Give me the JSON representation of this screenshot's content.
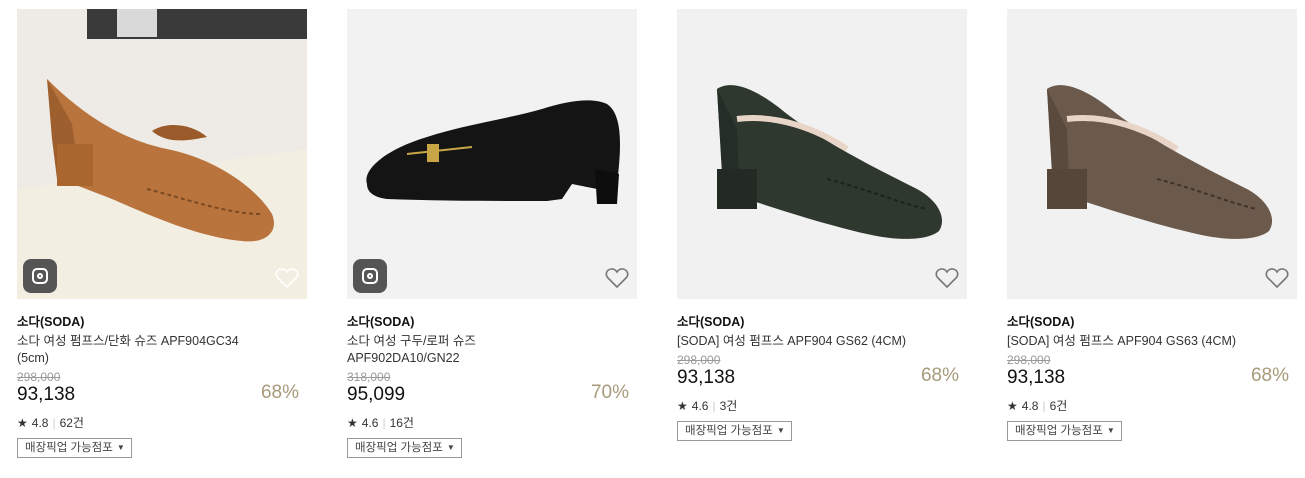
{
  "products": [
    {
      "brand": "소다(SODA)",
      "name": "소다 여성 펌프스/단화 슈즈 APF904GC34 (5cm)",
      "original_price": "298,000",
      "price": "93,138",
      "discount": "68%",
      "rating": "4.8",
      "reviews": "62건",
      "pickup_label": "매장픽업 가능점포",
      "has_instagram": true,
      "shoe_color": "#b8733f"
    },
    {
      "brand": "소다(SODA)",
      "name": "소다 여성 구두/로퍼 슈즈 APF902DA10/GN22",
      "original_price": "318,000",
      "price": "95,099",
      "discount": "70%",
      "rating": "4.6",
      "reviews": "16건",
      "pickup_label": "매장픽업 가능점포",
      "has_instagram": true,
      "shoe_color": "#151515"
    },
    {
      "brand": "소다(SODA)",
      "name": "[SODA] 여성 펌프스 APF904 GS62 (4CM)",
      "original_price": "298,000",
      "price": "93,138",
      "discount": "68%",
      "rating": "4.6",
      "reviews": "3건",
      "pickup_label": "매장픽업 가능점포",
      "has_instagram": false,
      "shoe_color": "#2f3a30"
    },
    {
      "brand": "소다(SODA)",
      "name": "[SODA] 여성 펌프스 APF904 GS63 (4CM)",
      "original_price": "298,000",
      "price": "93,138",
      "discount": "68%",
      "rating": "4.8",
      "reviews": "6건",
      "pickup_label": "매장픽업 가능점포",
      "has_instagram": false,
      "shoe_color": "#6b5a4c"
    }
  ],
  "icons": {
    "star": "★",
    "caret": "▼"
  },
  "colors": {
    "discount": "#a79a7a",
    "original_price": "#999999"
  }
}
